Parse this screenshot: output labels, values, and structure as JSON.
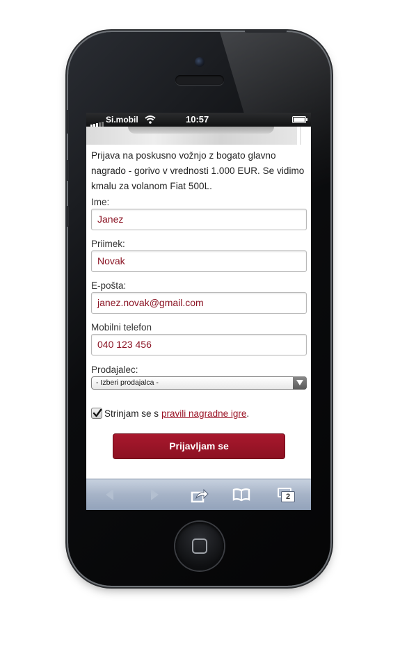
{
  "status_bar": {
    "carrier": "Si.mobil",
    "time": "10:57"
  },
  "content": {
    "intro_text": "Prijava na poskusno vožnjo z bogato glavno nagrado - gorivo v vrednosti 1.000 EUR. Se vidimo kmalu za volanom Fiat 500L.",
    "fields": [
      {
        "label": "Ime:",
        "value": "Janez"
      },
      {
        "label": "Priimek:",
        "value": "Novak"
      },
      {
        "label": "E-pošta:",
        "value": "janez.novak@gmail.com"
      },
      {
        "label": "Mobilni telefon",
        "value": "040 123 456"
      }
    ],
    "seller": {
      "label": "Prodajalec:",
      "selected": "- Izberi prodajalca -"
    },
    "agree": {
      "checked": true,
      "text": "Strinjam se s",
      "link": "pravili nagradne igre",
      "suffix": "."
    },
    "submit_label": "Prijavljam se"
  },
  "toolbar": {
    "items": [
      "back-icon",
      "forward-icon",
      "share-icon",
      "bookmarks-icon",
      "tabs-icon"
    ],
    "tabs_count": "2"
  },
  "colors": {
    "accent": "#9b1426",
    "input_text": "#8b1424",
    "toolbar": "#a6b3c7"
  }
}
